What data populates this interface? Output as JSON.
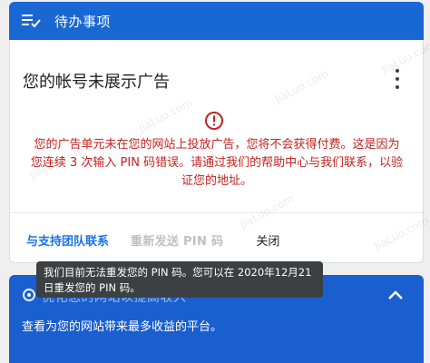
{
  "header": {
    "title": "待办事项",
    "icon": "checklist-icon"
  },
  "card": {
    "title": "您的帐号未展示广告",
    "menu_icon": "more-vert-icon",
    "alert_icon": "error-icon",
    "alert_text": "您的广告单元未在您的网站上投放广告，您将不会获得付费。这是因为您连续 3 次输入 PIN 码错误。请通过我们的帮助中心与我们联系，以验证您的地址。",
    "actions": {
      "contact_label": "与支持团队联系",
      "resend_label": "重新发送 PIN 码",
      "close_label": "关闭"
    }
  },
  "tooltip": {
    "text": "我们目前无法重发您的 PIN 码。您可以在 2020年12月21日重发您的 PIN 码。"
  },
  "panel": {
    "title": "优化您的网站以提高收入",
    "description": "查看为您的网站带来最多收益的平台。",
    "icon": "gear-icon",
    "chevron": "chevron-up-icon"
  },
  "watermark": {
    "text": "JiaLuo.com"
  },
  "colors": {
    "primary": "#1967d2",
    "error": "#c5221f",
    "link": "#1a73e8"
  }
}
